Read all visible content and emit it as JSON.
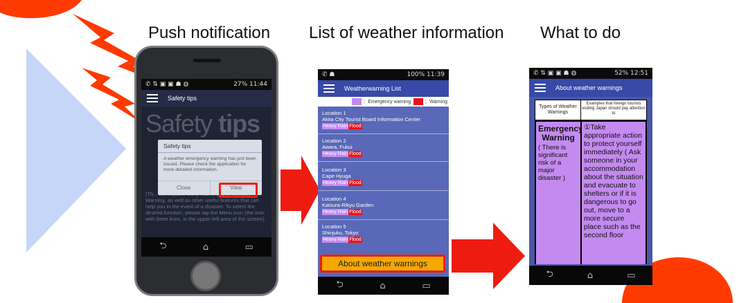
{
  "headings": {
    "push": "Push notification",
    "list": "List of weather information",
    "todo": "What to do"
  },
  "phone1": {
    "status_left": "✆ ⇅ ▣ ▣ ☗ ◍",
    "status_right": "27% 11:44",
    "appbar_title": "Safety tips",
    "hero_text_light": "Safety",
    "hero_text_bold": "tips",
    "dialog": {
      "title": "Safety tips",
      "body": "A weather emergency warning has just been issued. Please check the application for more detailed information.",
      "close_label": "Close",
      "view_label": "View"
    },
    "background_text": "(Th... Earthquake Early Warning and Tsunami Warning, as well as other useful features that can help you in the event of a disaster. To select the desired function, please tap the Menu icon (the icon with three lines, in the upper-left area of the screen)."
  },
  "phone2": {
    "status_left": "✆ ☗",
    "status_right": "100% 11:39",
    "appbar_title": "Weatherwarning List",
    "legend": {
      "emergency": "：Emergency warning",
      "warning": "：Warning",
      "emergency_color": "#c48af0",
      "warning_color": "#e8141c"
    },
    "locations": [
      {
        "label": "Location 1",
        "place": "Akita City Tourist Board Information Center",
        "tag1": "Heavy Rain",
        "tag2": "Flood"
      },
      {
        "label": "Location 2",
        "place": "Awara, Fukui",
        "tag1": "Heavy Rain",
        "tag2": "Flood"
      },
      {
        "label": "Location 3",
        "place": "Cape Hyuga",
        "tag1": "Heavy Rain",
        "tag2": "Flood"
      },
      {
        "label": "Location 4",
        "place": "Katsura-Rikyu Garden",
        "tag1": "Heavy Rain",
        "tag2": "Flood"
      },
      {
        "label": "Location 5",
        "place": "Shinjuku, Tokyo",
        "tag1": "Heavy Rain",
        "tag2": "Flood"
      }
    ],
    "button_label": "About weather warnings"
  },
  "phone3": {
    "status_left": "✆ ⇅ ▣ ▣ ☗ ◍",
    "status_right": "52% 12:51",
    "appbar_title": "About weather warnings",
    "table": {
      "col1_header": "Types of Weather Warnings",
      "col2_header": "Examples that foreign tourists visiting Japan should pay attention to",
      "row_type": "Emergency Warning",
      "row_type_note": "( There is significant risk of a major disaster )",
      "row_action": "①Take appropriate action to protect yourself immediately ( Ask someone in your accommodation about the situation and evacuate to shelters or if it is dangerous to go out, move to a more secure place such as the second floor"
    }
  },
  "nav_icons": {
    "back": "⮌",
    "home": "⌂",
    "recent": "▭"
  },
  "colors": {
    "accent_red": "#ee1c10",
    "appbar_blue": "#3849a8",
    "list_blue": "#5968b8",
    "emergency_purple": "#c48af0",
    "button_orange": "#f5a800",
    "decor_orange": "#ff3a00",
    "decor_blue": "#c5d6f8"
  }
}
